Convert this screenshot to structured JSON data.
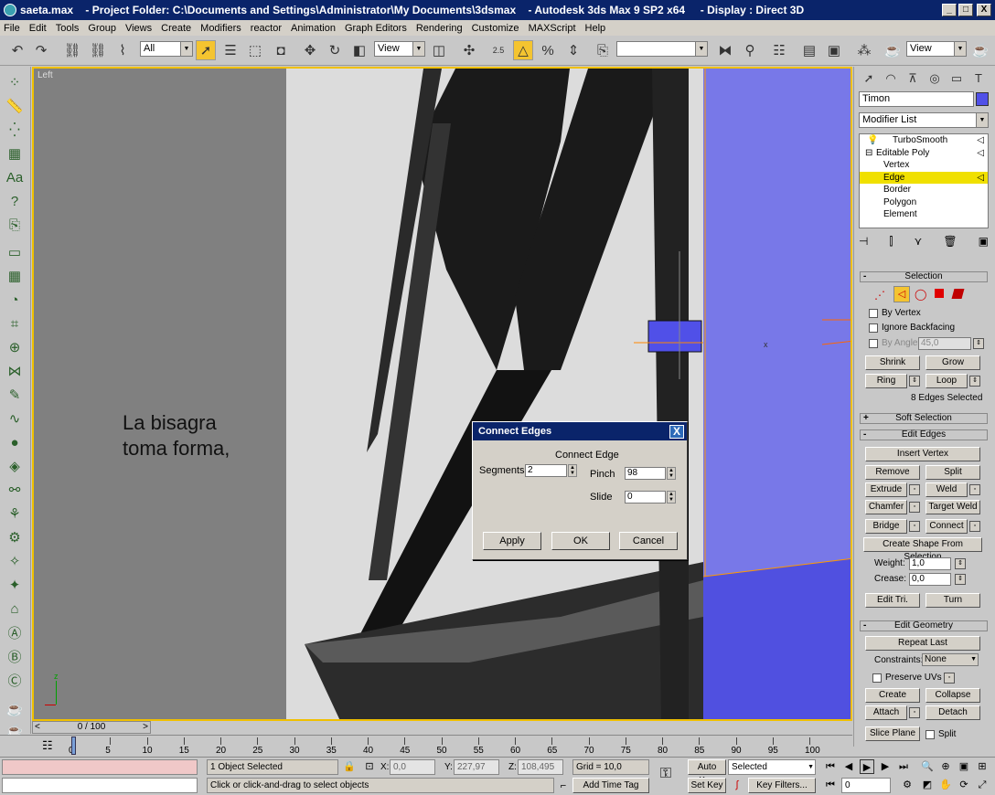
{
  "window": {
    "title": "saeta.max    - Project Folder: C:\\Documents and Settings\\Administrator\\My Documents\\3dsmax    - Autodesk 3ds Max 9 SP2 x64     - Display : Direct 3D",
    "minimize": "_",
    "maximize": "□",
    "close": "X"
  },
  "menu": [
    "File",
    "Edit",
    "Tools",
    "Group",
    "Views",
    "Create",
    "Modifiers",
    "reactor",
    "Animation",
    "Graph Editors",
    "Rendering",
    "Customize",
    "MAXScript",
    "Help"
  ],
  "toolbar": {
    "selection_filter": "All",
    "ref_coord": "View",
    "snap_angle": "2.5",
    "named_selection": "",
    "render_view": "View"
  },
  "viewport": {
    "label": "Left",
    "caption_line1": "La bisagra",
    "caption_line2": "toma forma,",
    "axis_z": "z",
    "axis_x": "x"
  },
  "dialog": {
    "title": "Connect Edges",
    "close": "X",
    "group_label": "Connect Edge",
    "segments_label": "Segments:",
    "segments_value": "2",
    "pinch_label": "Pinch",
    "pinch_value": "98",
    "slide_label": "Slide",
    "slide_value": "0",
    "apply": "Apply",
    "ok": "OK",
    "cancel": "Cancel"
  },
  "panel": {
    "object_name": "Timon",
    "object_color": "#5050e8",
    "modifier_list": "Modifier List",
    "stack": [
      "TurboSmooth",
      "Editable Poly",
      "Vertex",
      "Edge",
      "Border",
      "Polygon",
      "Element"
    ],
    "selection": {
      "title": "Selection",
      "by_vertex": "By Vertex",
      "ignore_backfacing": "Ignore Backfacing",
      "by_angle": "By Angle:",
      "angle_value": "45,0",
      "shrink": "Shrink",
      "grow": "Grow",
      "ring": "Ring",
      "loop": "Loop",
      "status": "8 Edges Selected"
    },
    "soft_selection": "Soft Selection",
    "edit_edges": {
      "title": "Edit Edges",
      "insert_vertex": "Insert Vertex",
      "remove": "Remove",
      "split": "Split",
      "extrude": "Extrude",
      "weld": "Weld",
      "chamfer": "Chamfer",
      "target_weld": "Target Weld",
      "bridge": "Bridge",
      "connect": "Connect",
      "create_shape": "Create Shape From Selection",
      "weight_label": "Weight:",
      "weight_value": "1,0",
      "crease_label": "Crease:",
      "crease_value": "0,0",
      "edit_tri": "Edit Tri.",
      "turn": "Turn"
    },
    "edit_geometry": {
      "title": "Edit Geometry",
      "repeat_last": "Repeat Last",
      "constraints_label": "Constraints:",
      "constraints_value": "None",
      "preserve_uvs": "Preserve UVs",
      "create": "Create",
      "collapse": "Collapse",
      "attach": "Attach",
      "detach": "Detach",
      "slice_plane": "Slice Plane",
      "split": "Split"
    }
  },
  "timeline": {
    "frame": "0 / 100",
    "ticks": [
      "0",
      "5",
      "10",
      "15",
      "20",
      "25",
      "30",
      "35",
      "40",
      "45",
      "50",
      "55",
      "60",
      "65",
      "70",
      "75",
      "80",
      "85",
      "90",
      "95",
      "100"
    ]
  },
  "status": {
    "selection_count": "1 Object Selected",
    "prompt": "Click or click-and-drag to select objects",
    "x_label": "X:",
    "x_value": "0,0",
    "y_label": "Y:",
    "y_value": "227,97",
    "z_label": "Z:",
    "z_value": "108,495",
    "grid": "Grid = 10,0",
    "add_time_tag": "Add Time Tag",
    "auto_key": "Auto Key",
    "set_key": "Set Key",
    "key_mode": "Selected",
    "key_filters": "Key Filters...",
    "current_frame": "0"
  }
}
